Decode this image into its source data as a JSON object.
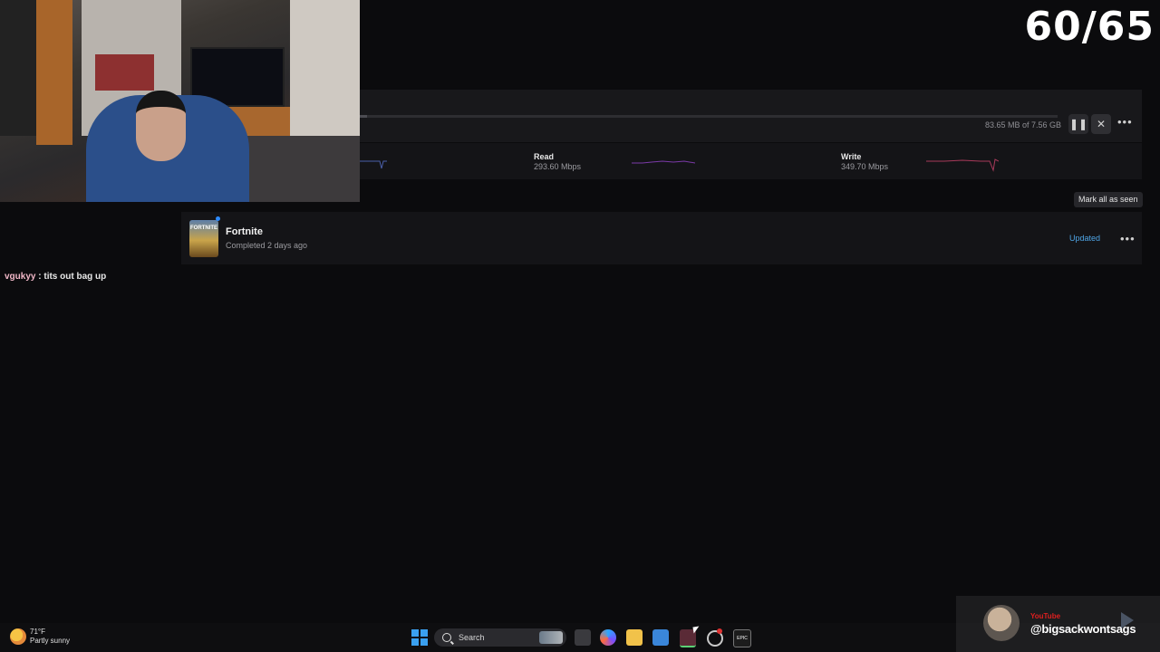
{
  "overlay": {
    "counter": "60/65"
  },
  "download": {
    "progress_fraction": 0.011,
    "size_text": "83.65 MB of 7.56 GB",
    "pause_icon": "pause-icon",
    "cancel_icon": "close-icon",
    "more_icon": "more-icon",
    "read": {
      "label": "Read",
      "value": "293.60 Mbps"
    },
    "write": {
      "label": "Write",
      "value": "349.70 Mbps"
    },
    "colors": {
      "read_spark": "#7b3aa8",
      "write_spark": "#a83a5a"
    }
  },
  "library": {
    "mark_seen_label": "Mark all as seen",
    "game": {
      "title": "Fortnite",
      "status": "Completed 2 days ago",
      "badge": "Updated",
      "thumb_text": "FORTNITE"
    }
  },
  "chat": {
    "user": "vgukyy",
    "separator": " : ",
    "message": "tits out bag up"
  },
  "taskbar": {
    "weather": {
      "temp": "71°F",
      "condition": "Partly sunny"
    },
    "search_label": "Search",
    "apps": [
      "file-manager-icon",
      "copilot-icon",
      "explorer-icon",
      "store-icon",
      "app-icon",
      "browser-icon",
      "epic-games-icon"
    ],
    "epic_text": "EPIC"
  },
  "youtube": {
    "tag": "YouTube",
    "handle": "@bigsackwontsags"
  }
}
